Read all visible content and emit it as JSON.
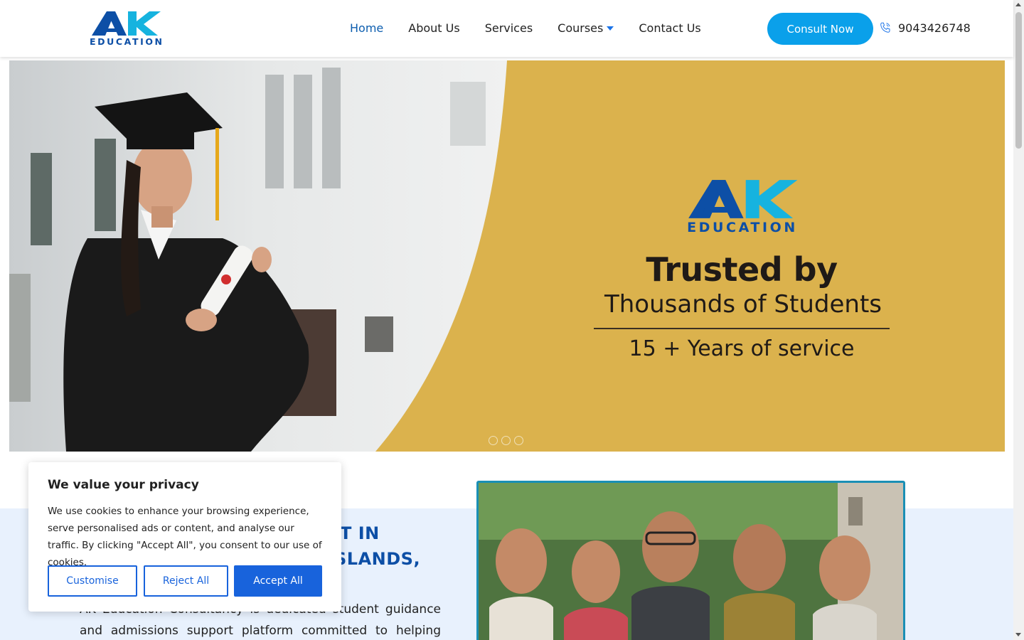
{
  "header": {
    "logo_text": "EDUCATION",
    "nav": [
      {
        "label": "Home",
        "active": true
      },
      {
        "label": "About Us"
      },
      {
        "label": "Services"
      },
      {
        "label": "Courses",
        "dropdown": true
      },
      {
        "label": "Contact Us"
      }
    ],
    "consult_label": "Consult Now",
    "phone": "9043426748",
    "phone_icon": "phone-icon"
  },
  "hero": {
    "logo_text": "EDUCATION",
    "title": "Trusted by",
    "subtitle": "Thousands of Students",
    "years": "15 + Years of service",
    "slides": 3,
    "active_slide": 1
  },
  "about": {
    "heading_line1": "T IN",
    "heading_line2": "SLANDS,",
    "text": "AK Education Consultancy is dedicated student guidance and admissions support platform committed to helping learners"
  },
  "cookie": {
    "title": "We value your privacy",
    "body": "We use cookies to enhance your browsing experience, serve personalised ads or content, and analyse our traffic. By clicking \"Accept All\", you consent to our use of cookies.",
    "customise_label": "Customise",
    "reject_label": "Reject All",
    "accept_label": "Accept All"
  },
  "colors": {
    "brand_blue": "#0d4fa6",
    "consult_blue": "#0aa0ea",
    "hero_gold": "#dbb24d",
    "cookie_blue": "#1863dc",
    "section_bg": "#e8f1fd"
  }
}
